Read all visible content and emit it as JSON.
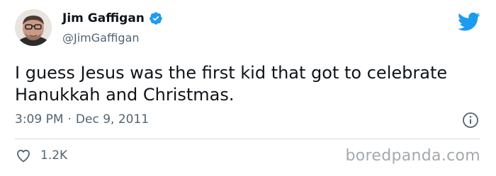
{
  "author": {
    "name": "Jim Gaffigan",
    "handle": "@JimGaffigan",
    "verified": true
  },
  "tweet": {
    "text": "I guess Jesus was the first kid that got to celebrate Hanukkah and Christmas.",
    "time": "3:09 PM",
    "separator": "·",
    "date": "Dec 9, 2011"
  },
  "engagement": {
    "likes": "1.2K"
  },
  "watermark": "boredpanda.com",
  "icons": {
    "platform": "twitter-bird-icon",
    "verified": "verified-badge-icon",
    "info": "info-icon",
    "like": "heart-icon"
  },
  "colors": {
    "brand_blue": "#1d9bf0",
    "text": "#0f1419",
    "muted": "#536471",
    "divider": "#cfd9de",
    "watermark": "#a4a9ad"
  }
}
